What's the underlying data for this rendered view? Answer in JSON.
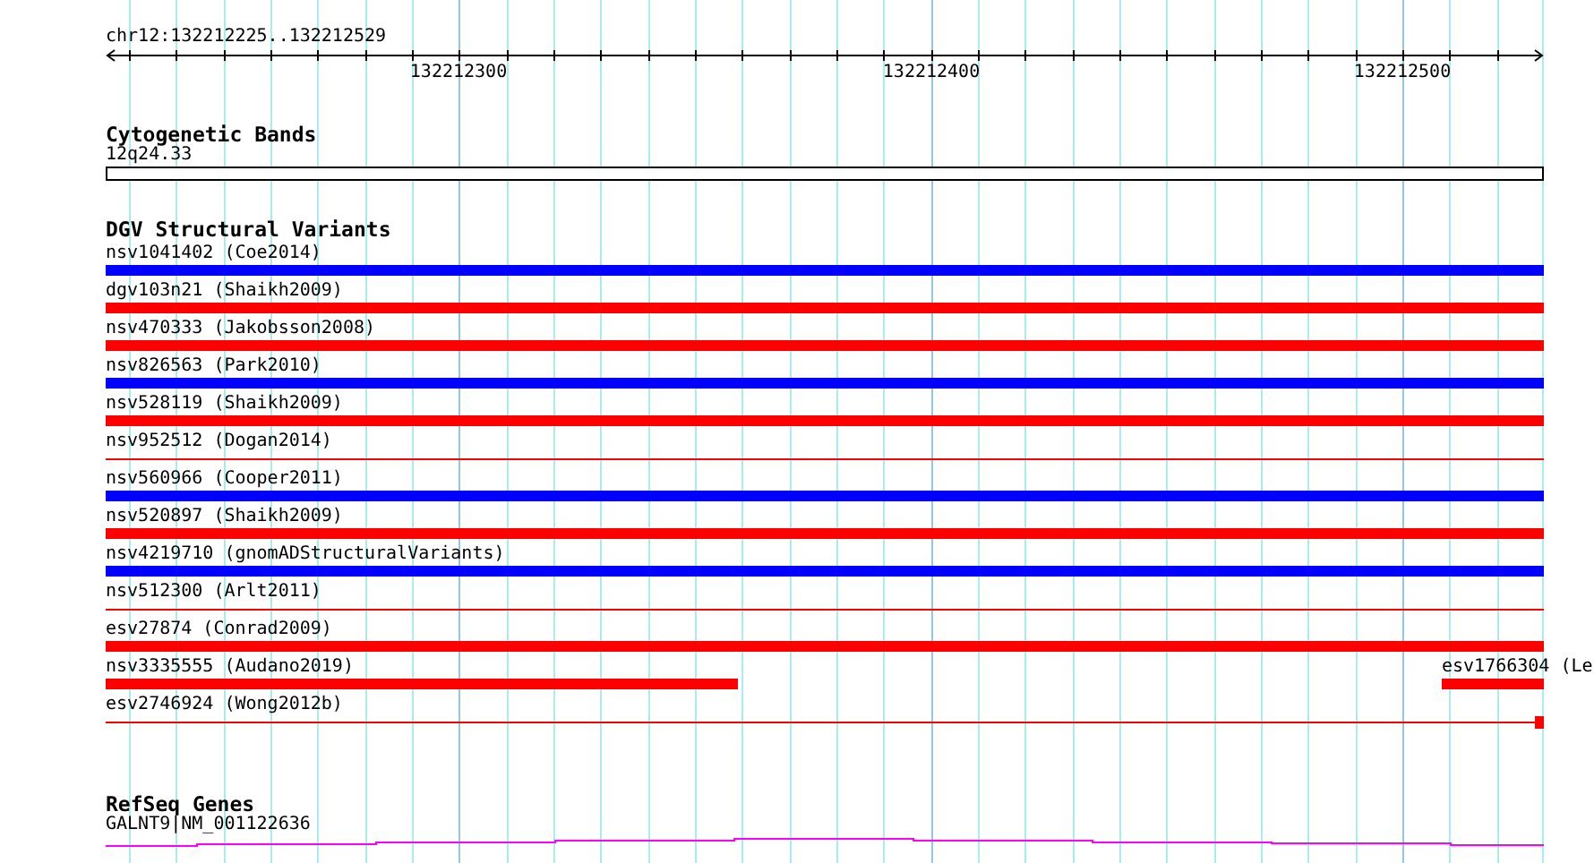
{
  "ruler": {
    "location": "chr12:132212225..132212529",
    "tick_labels": [
      "132212300",
      "132212400",
      "132212500"
    ]
  },
  "tracks": [
    {
      "kind": "bands",
      "title": "Cytogenetic Bands",
      "label": "12q24.33"
    },
    {
      "kind": "variants",
      "title": "DGV Structural Variants",
      "rows": [
        [
          {
            "label": "nsv1041402 (Coe2014)",
            "color": "#0000ff",
            "kind": "thick"
          }
        ],
        [
          {
            "label": "dgv103n21 (Shaikh2009)",
            "color": "#ff0000",
            "kind": "thick"
          }
        ],
        [
          {
            "label": "nsv470333 (Jakobsson2008)",
            "color": "#ff0000",
            "kind": "thick"
          }
        ],
        [
          {
            "label": "nsv826563 (Park2010)",
            "color": "#0000ff",
            "kind": "thick"
          }
        ],
        [
          {
            "label": "nsv528119 (Shaikh2009)",
            "color": "#ff0000",
            "kind": "thick"
          }
        ],
        [
          {
            "label": "nsv952512 (Dogan2014)",
            "color": "#ff0000",
            "kind": "thin"
          }
        ],
        [
          {
            "label": "nsv560966 (Cooper2011)",
            "color": "#0000ff",
            "kind": "thick"
          }
        ],
        [
          {
            "label": "nsv520897 (Shaikh2009)",
            "color": "#ff0000",
            "kind": "thick"
          }
        ],
        [
          {
            "label": "nsv4219710 (gnomADStructuralVariants)",
            "color": "#0000ff",
            "kind": "thick"
          }
        ],
        [
          {
            "label": "nsv512300 (Arlt2011)",
            "color": "#ff0000",
            "kind": "thin"
          }
        ],
        [
          {
            "label": "esv27874 (Conrad2009)",
            "color": "#ff0000",
            "kind": "thick"
          }
        ],
        [
          {
            "label": "nsv3335555 (Audano2019)",
            "color": "#ff0000",
            "kind": "thick-left"
          },
          {
            "label": "esv1766304 (Le",
            "color": "#ff0000",
            "kind": "thick-right"
          }
        ],
        [
          {
            "label": "esv2746924 (Wong2012b)",
            "color": "#ff0000",
            "kind": "thin-capped"
          }
        ]
      ]
    },
    {
      "kind": "genes",
      "title": "RefSeq Genes",
      "label": "GALNT9|NM_001122636"
    }
  ]
}
